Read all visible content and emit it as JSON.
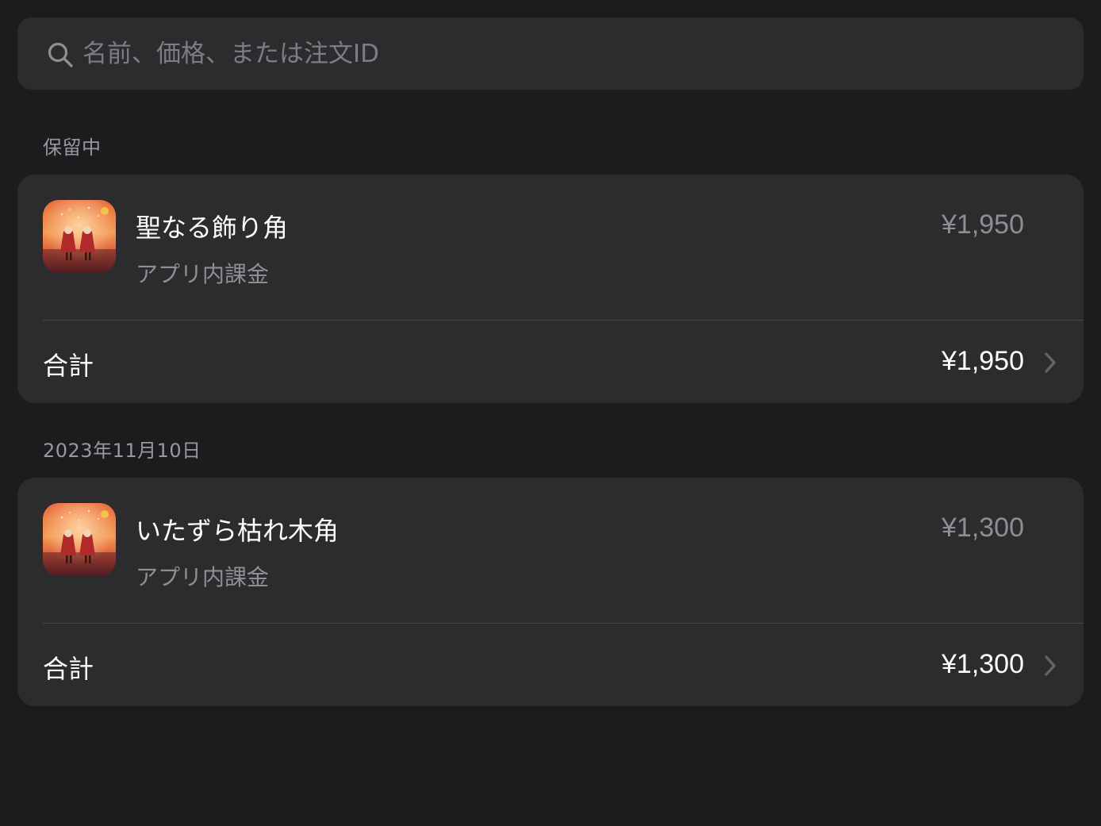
{
  "search": {
    "placeholder": "名前、価格、または注文ID",
    "icon": "search-icon"
  },
  "sections": [
    {
      "header": "保留中",
      "item": {
        "title": "聖なる飾り角",
        "subtitle": "アプリ内課金",
        "price": "¥1,950",
        "icon": "app-icon"
      },
      "total_label": "合計",
      "total_amount": "¥1,950"
    },
    {
      "header": "2023年11月10日",
      "item": {
        "title": "いたずら枯れ木角",
        "subtitle": "アプリ内課金",
        "price": "¥1,300",
        "icon": "app-icon"
      },
      "total_label": "合計",
      "total_amount": "¥1,300"
    }
  ],
  "colors": {
    "background": "#1c1c1e",
    "card": "#2c2c2e",
    "secondary_text": "#8e8e93",
    "divider": "#48484a"
  }
}
